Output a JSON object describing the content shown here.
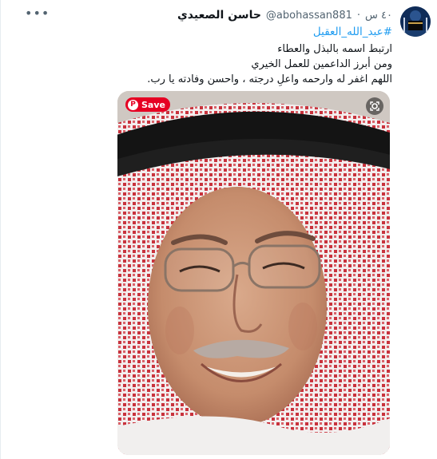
{
  "post": {
    "author_name": "حاسن الصعيدي",
    "handle": "@abohassan881",
    "separator": "·",
    "time": "٤٠ س",
    "hashtag": "#عبد_الله_العقيل",
    "lines": [
      "ارتبط اسمه بالبذل والعطاء",
      "ومن أبرز الداعمين للعمل الخيري",
      "اللهم اغفر له وارحمه  واعلِ درجته ، واحسن وفادته يا رب."
    ],
    "more_icon": "more-horizontal-icon"
  },
  "media": {
    "save_label": "Save",
    "pinterest_glyph": "P",
    "lens_icon": "google-lens-icon",
    "colors": {
      "pinterest_red": "#e60023",
      "shemagh_red": "#c8323c",
      "agal_black": "#141414",
      "link_blue": "#1d9bf0"
    }
  }
}
